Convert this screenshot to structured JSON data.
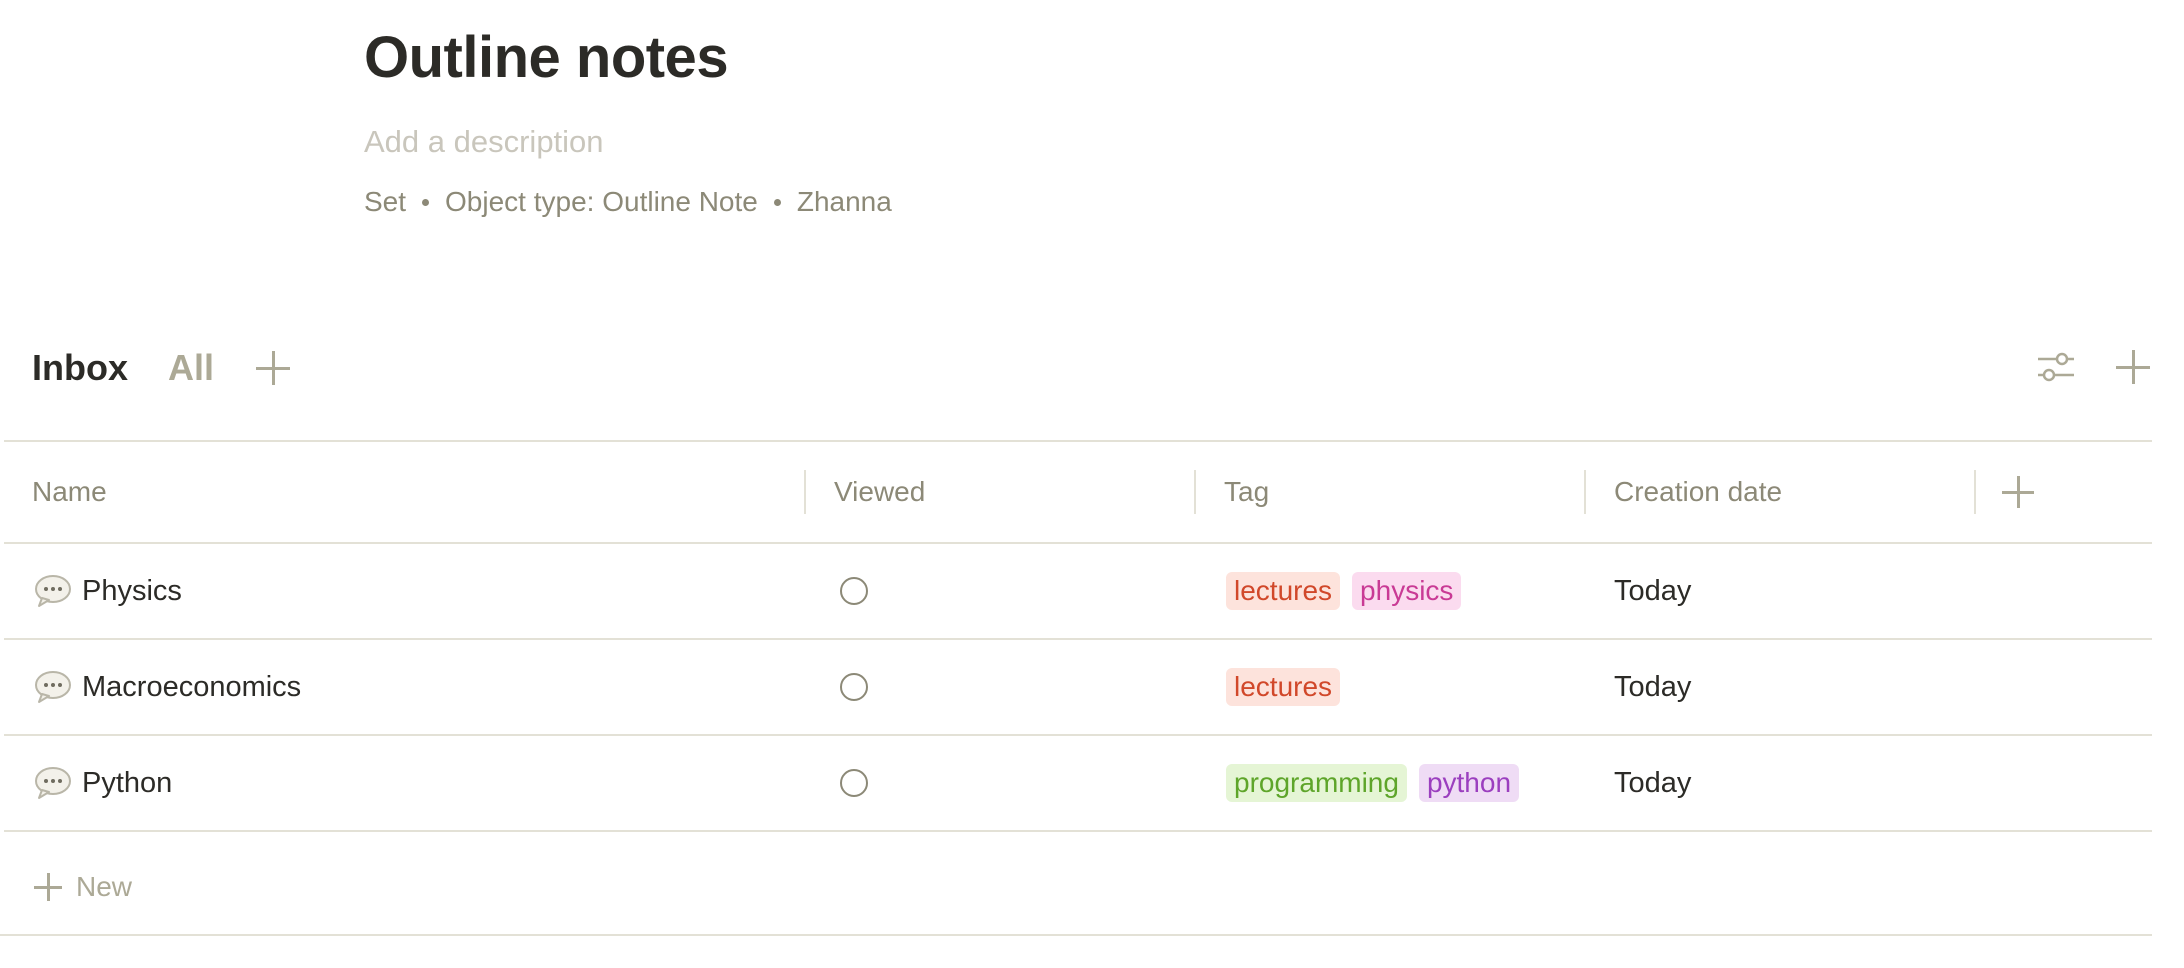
{
  "set": {
    "title": "Outline notes",
    "description_placeholder": "Add a description",
    "meta": {
      "kind": "Set",
      "object_type": "Object type: Outline Note",
      "author": "Zhanna"
    }
  },
  "views": {
    "tabs": [
      {
        "label": "Inbox",
        "active": true
      },
      {
        "label": "All",
        "active": false
      }
    ],
    "add_icon": "plus-icon"
  },
  "toolbar": {
    "settings_icon": "view-settings-icon",
    "add_icon": "plus-icon"
  },
  "table": {
    "columns": [
      "Name",
      "Viewed",
      "Tag",
      "Creation date"
    ],
    "add_column_icon": "plus-icon",
    "rows": [
      {
        "icon": "chat-bubble-icon",
        "name": "Physics",
        "viewed": false,
        "tags": [
          {
            "label": "lectures",
            "bg": "#fde3dc",
            "fg": "#d1482a"
          },
          {
            "label": "physics",
            "bg": "#fbdbef",
            "fg": "#c93a95"
          }
        ],
        "created": "Today"
      },
      {
        "icon": "chat-bubble-icon",
        "name": "Macroeconomics",
        "viewed": false,
        "tags": [
          {
            "label": "lectures",
            "bg": "#fde3dc",
            "fg": "#d1482a"
          }
        ],
        "created": "Today"
      },
      {
        "icon": "chat-bubble-icon",
        "name": "Python",
        "viewed": false,
        "tags": [
          {
            "label": "programming",
            "bg": "#e5f5d5",
            "fg": "#5ea52a"
          },
          {
            "label": "python",
            "bg": "#efdcf5",
            "fg": "#9b3fbf"
          }
        ],
        "created": "Today"
      }
    ],
    "new_row_label": "New"
  },
  "colors": {
    "text": "#2c2b27",
    "muted": "#8c8977",
    "placeholder": "#c9c6bc",
    "border": "#e3e1d6"
  }
}
